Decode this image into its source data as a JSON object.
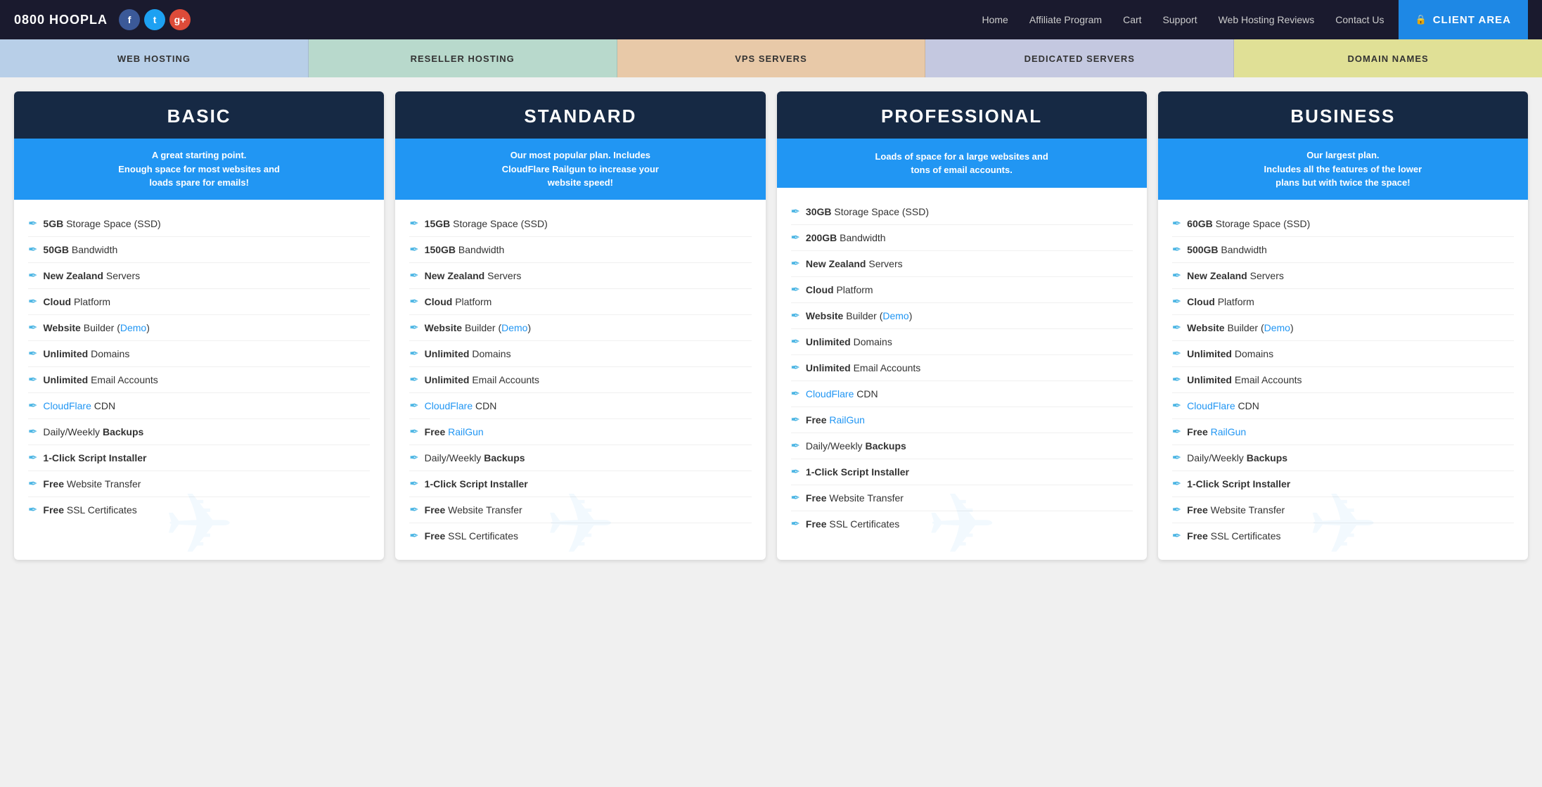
{
  "brand": "0800 HOOPLA",
  "social": [
    {
      "name": "facebook",
      "label": "f",
      "class": "social-fb"
    },
    {
      "name": "twitter",
      "label": "t",
      "class": "social-tw"
    },
    {
      "name": "google-plus",
      "label": "g+",
      "class": "social-gp"
    }
  ],
  "nav": {
    "links": [
      "Home",
      "Affiliate Program",
      "Cart",
      "Support",
      "Web Hosting Reviews",
      "Contact Us"
    ],
    "client_area": "CLIENT AREA"
  },
  "categories": [
    {
      "label": "WEB HOSTING",
      "class": "cat-web"
    },
    {
      "label": "RESELLER HOSTING",
      "class": "cat-reseller"
    },
    {
      "label": "VPS SERVERS",
      "class": "cat-vps"
    },
    {
      "label": "DEDICATED SERVERS",
      "class": "cat-dedicated"
    },
    {
      "label": "DOMAIN NAMES",
      "class": "cat-domain"
    }
  ],
  "plans": [
    {
      "title": "BASIC",
      "subtitle": "A great starting point.\nEnough space for most websites and\nloads spare for emails!",
      "features": [
        {
          "bold": "5GB",
          "text": " Storage Space (SSD)"
        },
        {
          "bold": "50GB",
          "text": " Bandwidth"
        },
        {
          "bold": "New Zealand",
          "text": " Servers"
        },
        {
          "bold": "Cloud",
          "text": " Platform"
        },
        {
          "bold": "Website",
          "text": " Builder (",
          "link": "Demo",
          "after": ")"
        },
        {
          "bold": "Unlimited",
          "text": " Domains"
        },
        {
          "bold": "Unlimited",
          "text": " Email Accounts"
        },
        {
          "bold_link": "CloudFlare",
          "text": " CDN"
        },
        {
          "text": "Daily/Weekly ",
          "bold": "Backups"
        },
        {
          "bold": "1-Click Script Installer"
        },
        {
          "bold": "Free",
          "text": " Website Transfer"
        },
        {
          "bold": "Free",
          "text": " SSL Certificates"
        }
      ]
    },
    {
      "title": "STANDARD",
      "subtitle": "Our most popular plan. Includes\nCloudFlare Railgun to increase your\nwebsite speed!",
      "features": [
        {
          "bold": "15GB",
          "text": " Storage Space (SSD)"
        },
        {
          "bold": "150GB",
          "text": " Bandwidth"
        },
        {
          "bold": "New Zealand",
          "text": " Servers"
        },
        {
          "bold": "Cloud",
          "text": " Platform"
        },
        {
          "bold": "Website",
          "text": " Builder (",
          "link": "Demo",
          "after": ")"
        },
        {
          "bold": "Unlimited",
          "text": " Domains"
        },
        {
          "bold": "Unlimited",
          "text": " Email Accounts"
        },
        {
          "bold_link": "CloudFlare",
          "text": " CDN"
        },
        {
          "bold": "Free",
          "text": " ",
          "link": "RailGun"
        },
        {
          "text": "Daily/Weekly ",
          "bold": "Backups"
        },
        {
          "bold": "1-Click Script Installer"
        },
        {
          "bold": "Free",
          "text": " Website Transfer"
        },
        {
          "bold": "Free",
          "text": " SSL Certificates"
        }
      ]
    },
    {
      "title": "PROFESSIONAL",
      "subtitle": "Loads of space for a large websites and\ntons of email accounts.",
      "features": [
        {
          "bold": "30GB",
          "text": " Storage Space (SSD)"
        },
        {
          "bold": "200GB",
          "text": " Bandwidth"
        },
        {
          "bold": "New Zealand",
          "text": " Servers"
        },
        {
          "bold": "Cloud",
          "text": " Platform"
        },
        {
          "bold": "Website",
          "text": " Builder (",
          "link": "Demo",
          "after": ")"
        },
        {
          "bold": "Unlimited",
          "text": " Domains"
        },
        {
          "bold": "Unlimited",
          "text": " Email Accounts"
        },
        {
          "bold_link": "CloudFlare",
          "text": " CDN"
        },
        {
          "bold": "Free",
          "text": " ",
          "link": "RailGun"
        },
        {
          "text": "Daily/Weekly ",
          "bold": "Backups"
        },
        {
          "bold": "1-Click Script Installer"
        },
        {
          "bold": "Free",
          "text": " Website Transfer"
        },
        {
          "bold": "Free",
          "text": " SSL Certificates"
        }
      ]
    },
    {
      "title": "BUSINESS",
      "subtitle": "Our largest plan.\nIncludes all the features of the lower\nplans but with twice the space!",
      "features": [
        {
          "bold": "60GB",
          "text": " Storage Space (SSD)"
        },
        {
          "bold": "500GB",
          "text": " Bandwidth"
        },
        {
          "bold": "New Zealand",
          "text": " Servers"
        },
        {
          "bold": "Cloud",
          "text": " Platform"
        },
        {
          "bold": "Website",
          "text": " Builder (",
          "link": "Demo",
          "after": ")"
        },
        {
          "bold": "Unlimited",
          "text": " Domains"
        },
        {
          "bold": "Unlimited",
          "text": " Email Accounts"
        },
        {
          "bold_link": "CloudFlare",
          "text": " CDN"
        },
        {
          "bold": "Free",
          "text": " ",
          "link": "RailGun"
        },
        {
          "text": "Daily/Weekly ",
          "bold": "Backups"
        },
        {
          "bold": "1-Click Script Installer"
        },
        {
          "bold": "Free",
          "text": " Website Transfer"
        },
        {
          "bold": "Free",
          "text": " SSL Certificates"
        }
      ]
    }
  ]
}
